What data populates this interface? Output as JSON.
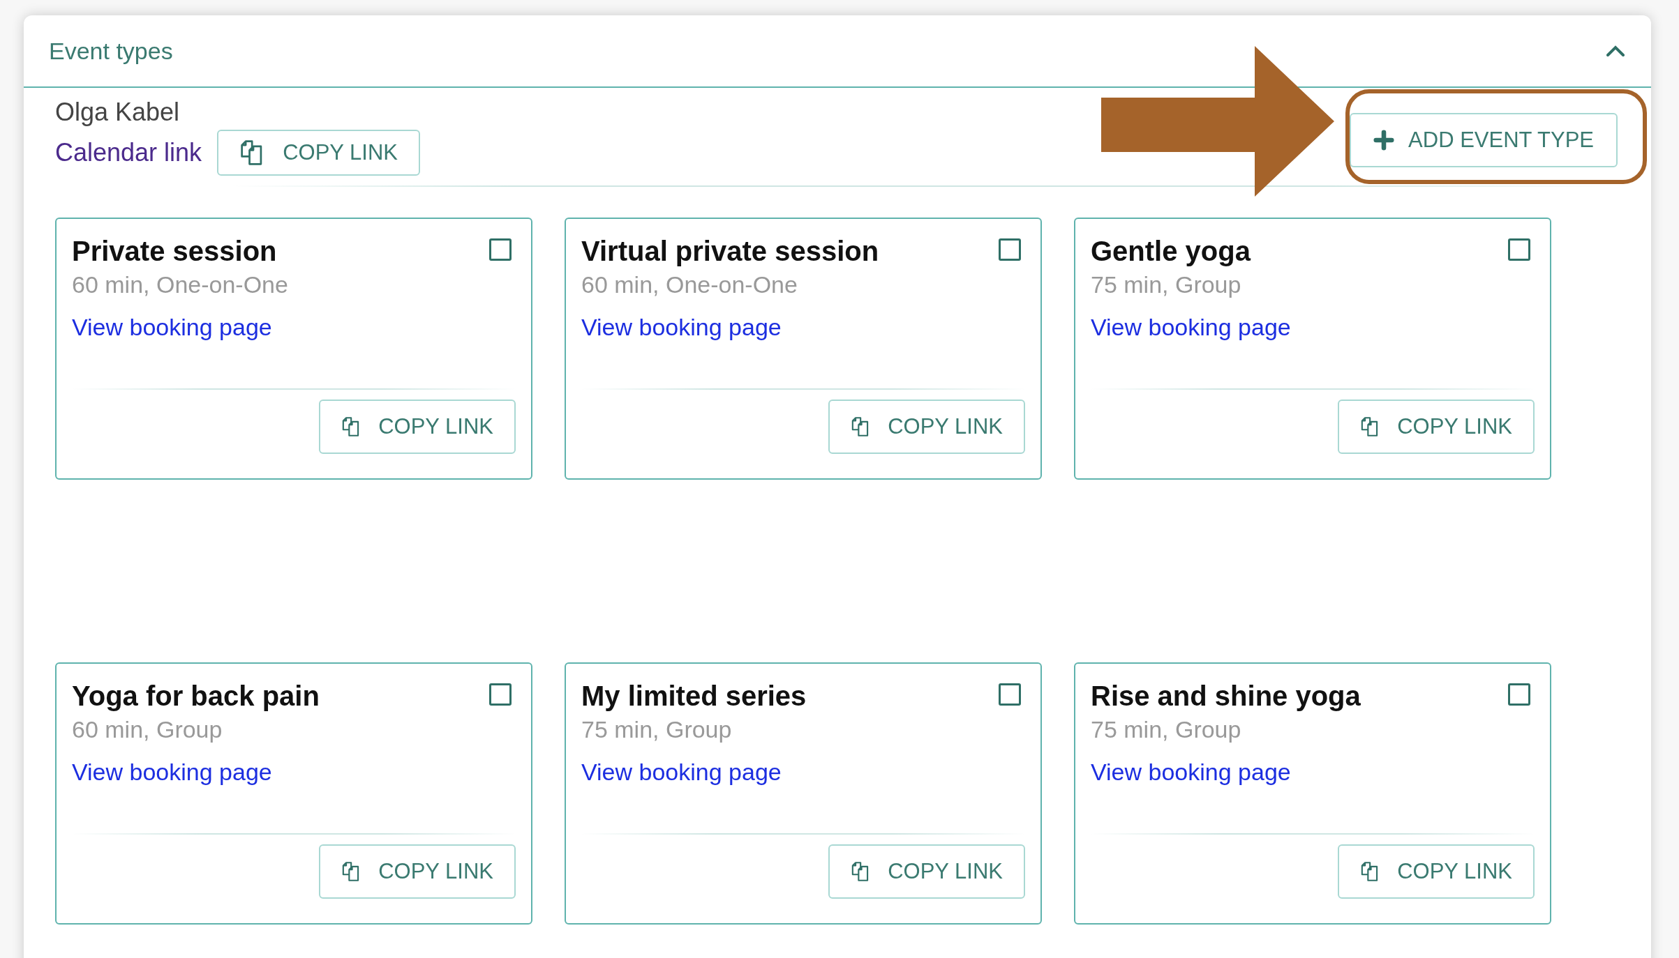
{
  "panel": {
    "title": "Event types",
    "expanded": true
  },
  "owner": {
    "name": "Olga Kabel",
    "calendar_link": "Calendar link",
    "copy_button": "COPY LINK"
  },
  "add_button": "ADD EVENT TYPE",
  "cards": [
    {
      "title": "Private session",
      "details": "60 min, One-on-One",
      "link": "View booking page",
      "copy_button": "COPY LINK",
      "checked": false
    },
    {
      "title": "Virtual private session",
      "details": "60 min, One-on-One",
      "link": "View booking page",
      "copy_button": "COPY LINK",
      "checked": false
    },
    {
      "title": "Gentle yoga",
      "details": "75 min, Group",
      "link": "View booking page",
      "copy_button": "COPY LINK",
      "checked": false
    },
    {
      "title": "Yoga for back pain",
      "details": "60 min, Group",
      "link": "View booking page",
      "copy_button": "COPY LINK",
      "checked": false
    },
    {
      "title": "My limited series",
      "details": "75 min, Group",
      "link": "View booking page",
      "copy_button": "COPY LINK",
      "checked": false
    },
    {
      "title": "Rise and shine yoga",
      "details": "75 min, Group",
      "link": "View booking page",
      "copy_button": "COPY LINK",
      "checked": false
    }
  ]
}
